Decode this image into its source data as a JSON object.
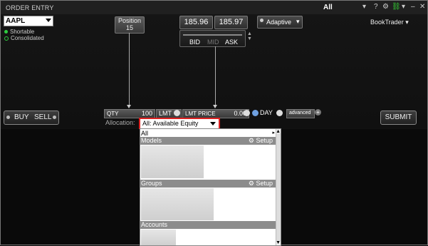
{
  "window": {
    "title": "ORDER ENTRY",
    "filter_label": "All",
    "help_label": "?"
  },
  "symbol": {
    "value": "AAPL"
  },
  "status": [
    {
      "label": "Shortable",
      "color": "#2ecc40"
    },
    {
      "label": "Consolidated",
      "color": "#2ecc40"
    }
  ],
  "position": {
    "label": "Position",
    "value": "15"
  },
  "prices": {
    "bid": "185.96",
    "ask": "185.97"
  },
  "bid_mid_ask": {
    "bid_label": "BID",
    "mid_label": "MID",
    "ask_label": "ASK"
  },
  "algo": {
    "label": "Adaptive"
  },
  "booktrader": {
    "label": "BookTrader"
  },
  "buttons": {
    "buy": "BUY",
    "sell": "SELL",
    "submit": "SUBMIT"
  },
  "order_line": {
    "qty_label": "QTY",
    "qty_value": "100",
    "type": "LMT",
    "price_label": "LMT PRICE",
    "price_value": "0.00",
    "tif": "DAY",
    "advanced": "advanced"
  },
  "allocation": {
    "label": "Allocation:",
    "selected": "All: Available Equity"
  },
  "dropdown": {
    "all_item": "All",
    "sections": [
      {
        "name": "Models",
        "setup": "Setup"
      },
      {
        "name": "Groups",
        "setup": "Setup"
      },
      {
        "name": "Accounts"
      }
    ]
  }
}
